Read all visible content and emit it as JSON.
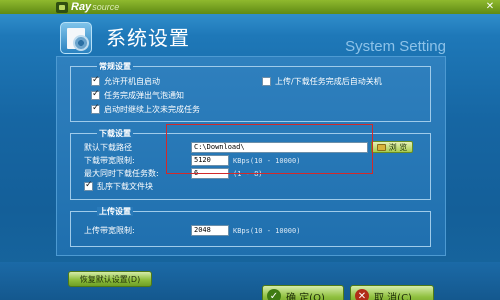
{
  "window": {
    "brand_ray": "Ray",
    "brand_source": "source",
    "close_glyph": "✕"
  },
  "header": {
    "title": "系统设置",
    "title_en": "System Setting",
    "icon": "settings-gear-icon"
  },
  "general": {
    "legend": "常规设置",
    "items": [
      {
        "label": "允许开机自启动",
        "checked": true
      },
      {
        "label": "任务完成弹出气泡通知",
        "checked": true
      },
      {
        "label": "启动时继续上次未完成任务",
        "checked": true
      },
      {
        "label": "上传/下载任务完成后自动关机",
        "checked": false
      }
    ]
  },
  "download": {
    "legend": "下载设置",
    "path_label": "默认下载路径",
    "path_value": "C:\\Download\\",
    "browse_label": "浏 览",
    "bandwidth_label": "下载带宽限制:",
    "bandwidth_value": "5120",
    "bandwidth_unit": "KBps(10 - 10000)",
    "max_tasks_label": "最大同时下载任务数:",
    "max_tasks_value": "6",
    "max_tasks_range": "(1 - 8)",
    "shuffle_label": "乱序下载文件块",
    "shuffle_checked": true
  },
  "upload": {
    "legend": "上传设置",
    "bandwidth_label": "上传带宽限制:",
    "bandwidth_value": "2048",
    "bandwidth_unit": "KBps(10 - 10000)"
  },
  "footer": {
    "restore_label": "恢复默认设置(D)",
    "ok_label": "确 定(O)",
    "cancel_label": "取 消(C)"
  },
  "colors": {
    "accent_green": "#8fc03e",
    "background_blue": "#1e78b8",
    "highlight_red": "#d22a2a"
  }
}
